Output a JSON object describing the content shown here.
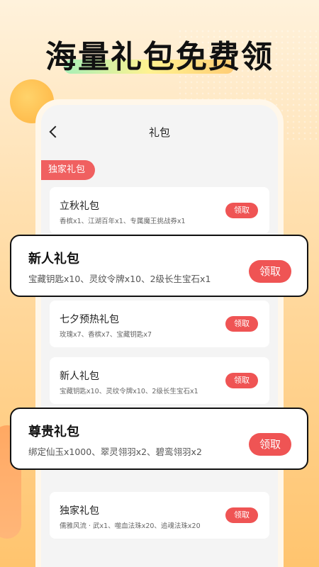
{
  "banner": {
    "headline": "海量礼包免费领"
  },
  "header": {
    "back_icon": "chevron-left-icon",
    "title": "礼包"
  },
  "section_tag": "独家礼包",
  "cards": [
    {
      "title": "立秋礼包",
      "items": "香槟x1、江湖百年x1、专属魔王挑战券x1",
      "button": "领取"
    },
    {
      "title": "七夕预热礼包",
      "items": "玫瑰x7、香槟x7、宝藏钥匙x7",
      "button": "领取"
    },
    {
      "title": "新人礼包",
      "items": "宝藏钥匙x10、灵纹令牌x10、2级长生宝石x1",
      "button": "领取"
    },
    {
      "title": "独家礼包",
      "items": "儒雅风流 · 武x1、噬血法珠x20、追魂法珠x20",
      "button": "领取"
    }
  ],
  "popups": [
    {
      "title": "新人礼包",
      "items": "宝藏钥匙x10、灵纹令牌x10、2级长生宝石x1",
      "button": "领取"
    },
    {
      "title": "尊贵礼包",
      "items": "绑定仙玉x1000、翠灵翎羽x2、碧鸾翎羽x2",
      "button": "领取"
    }
  ],
  "colors": {
    "accent": "#ef5454",
    "tag_bg": "#f06060"
  }
}
